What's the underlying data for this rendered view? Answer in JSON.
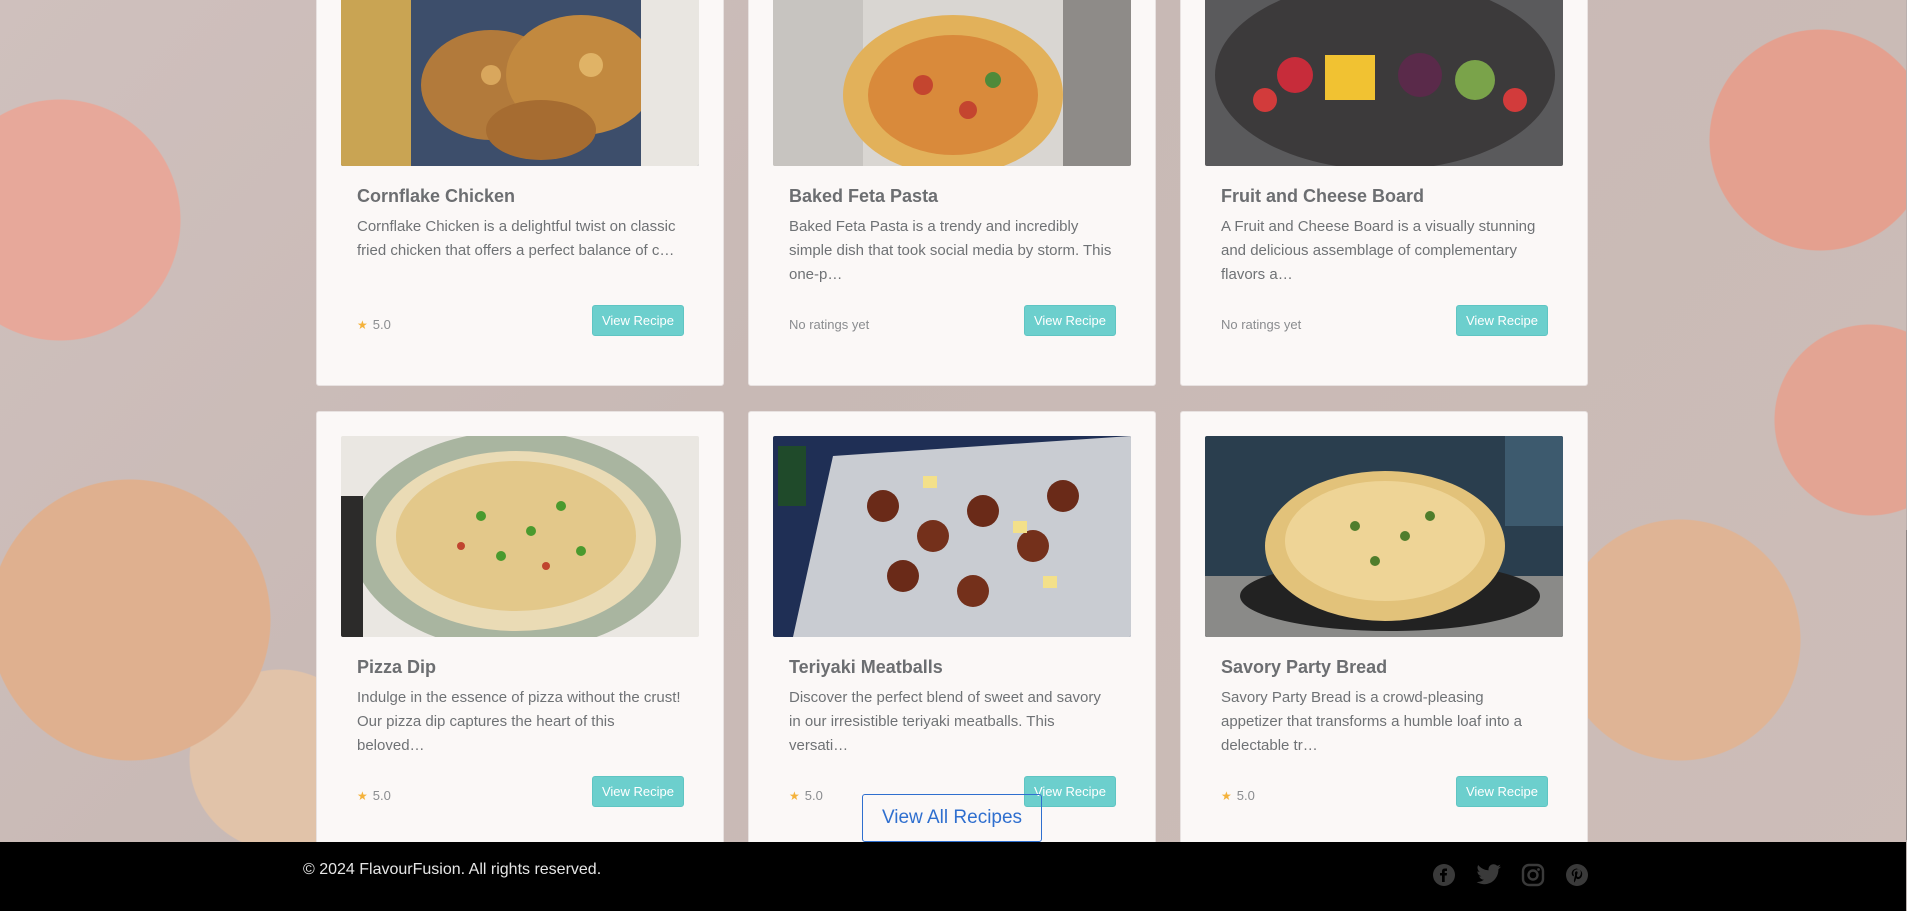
{
  "recipes": [
    {
      "title": "Cornflake Chicken",
      "description": "Cornflake Chicken is a delightful twist on classic fried chicken that offers a perfect balance of c…",
      "rating": "5.0",
      "has_rating": true,
      "button_label": "View Recipe",
      "image": "fried-chicken-photo"
    },
    {
      "title": "Baked Feta Pasta",
      "description": "Baked Feta Pasta is a trendy and incredibly simple dish that took social media by storm. This one-p…",
      "rating": "No ratings yet",
      "has_rating": false,
      "button_label": "View Recipe",
      "image": "feta-pasta-photo"
    },
    {
      "title": "Fruit and Cheese Board",
      "description": "A Fruit and Cheese Board is a visually stunning and delicious assemblage of complementary flavors a…",
      "rating": "No ratings yet",
      "has_rating": false,
      "button_label": "View Recipe",
      "image": "fruit-board-photo"
    },
    {
      "title": "Pizza Dip",
      "description": "Indulge in the essence of pizza without the crust! Our pizza dip captures the heart of this beloved…",
      "rating": "5.0",
      "has_rating": true,
      "button_label": "View Recipe",
      "image": "pizza-dip-photo"
    },
    {
      "title": "Teriyaki Meatballs",
      "description": "Discover the perfect blend of sweet and savory in our irresistible teriyaki meatballs. This versati…",
      "rating": "5.0",
      "has_rating": true,
      "button_label": "View Recipe",
      "image": "meatballs-photo"
    },
    {
      "title": "Savory Party Bread",
      "description": "Savory Party Bread is a crowd-pleasing appetizer that transforms a humble loaf into a delectable tr…",
      "rating": "5.0",
      "has_rating": true,
      "button_label": "View Recipe",
      "image": "party-bread-photo"
    }
  ],
  "view_all_label": "View All Recipes",
  "footer": {
    "copyright": "© 2024 FlavourFusion. All rights reserved.",
    "social_icons": [
      "facebook-icon",
      "twitter-icon",
      "instagram-icon",
      "pinterest-icon"
    ]
  },
  "colors": {
    "accent_button": "#6ccfcd",
    "view_all_border": "#2f6fcf",
    "star": "#f4b23b",
    "footer_bg": "#000000"
  }
}
